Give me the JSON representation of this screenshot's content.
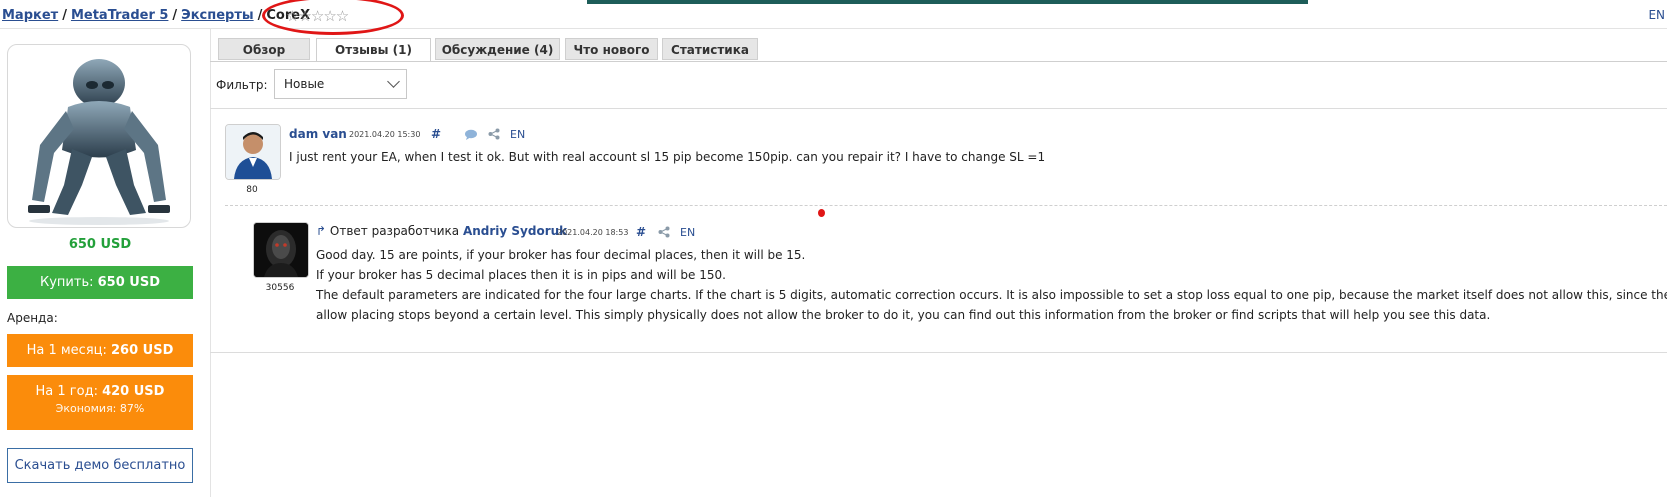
{
  "breadcrumb": {
    "items": [
      "Маркет",
      "MetaTrader 5",
      "Эксперты"
    ],
    "current": "CoreX",
    "separator": "/"
  },
  "rating": {
    "stars": "☆☆☆☆☆",
    "value": 0,
    "max": 5
  },
  "lang_top": "EN",
  "sidebar": {
    "price": "650 USD",
    "buy_label": "Купить: ",
    "buy_price": "650 USD",
    "rent_label": "Аренда:",
    "rent_month_label": "На 1 месяц: ",
    "rent_month_price": "260 USD",
    "rent_year_label": "На 1 год: ",
    "rent_year_price": "420 USD",
    "rent_year_saving": "Экономия: 87%",
    "demo_label": "Скачать демо бесплатно"
  },
  "tabs": [
    {
      "label": "Обзор",
      "active": false
    },
    {
      "label": "Отзывы (1)",
      "active": true
    },
    {
      "label": "Обсуждение (4)",
      "active": false
    },
    {
      "label": "Что нового",
      "active": false
    },
    {
      "label": "Статистика",
      "active": false
    }
  ],
  "filter": {
    "label": "Фильтр:",
    "selected": "Новые"
  },
  "review": {
    "author": "dam van",
    "date": "2021.04.20 15:30",
    "hash": "#",
    "lang": "EN",
    "count": "80",
    "text": "I just rent your EA, when I test it ok. But with real account sl 15 pip become 150pip. can you repair it? I have to change SL =1"
  },
  "reply": {
    "prefix": "Ответ разработчика ",
    "author": "Andriy Sydoruk",
    "date": "2021.04.20 18:53",
    "hash": "#",
    "lang": "EN",
    "count": "30556",
    "lines": [
      "Good day. 15 are points, if your broker has four decimal places, then it will be 15.",
      "If your broker has 5 decimal places then it is in pips and will be 150.",
      "The default parameters are indicated for the four large charts. If the chart is 5 digits, automatic correction occurs. It is also impossible to set a stop loss equal to one pip, because the market itself does not allow this, since the fre",
      "allow placing stops beyond a certain level. This simply physically does not allow the broker to do it, you can find out this information from the broker or find scripts that will help you see this data."
    ]
  },
  "colors": {
    "green": "#3cb043",
    "orange": "#fb8c0b",
    "link": "#2a4e91",
    "annotation": "#e01616"
  }
}
